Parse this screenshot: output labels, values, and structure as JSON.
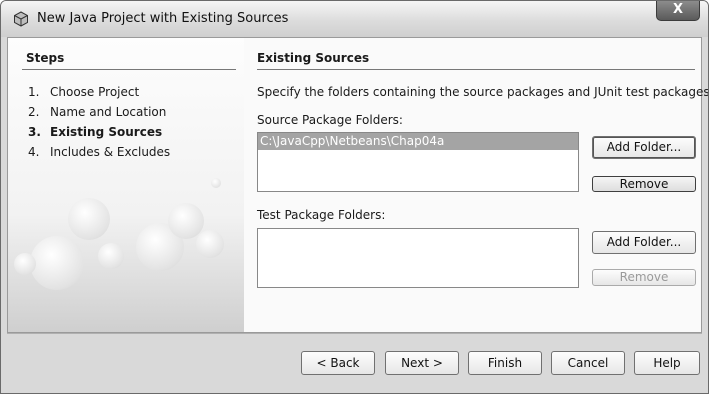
{
  "window": {
    "title": "New Java Project with Existing Sources",
    "close_glyph": "X",
    "icon": "java-project-icon"
  },
  "steps": {
    "title": "Steps",
    "items": [
      {
        "num": "1.",
        "label": "Choose Project"
      },
      {
        "num": "2.",
        "label": "Name and Location"
      },
      {
        "num": "3.",
        "label": "Existing Sources"
      },
      {
        "num": "4.",
        "label": "Includes & Excludes"
      }
    ],
    "current_index": 2
  },
  "panel": {
    "title": "Existing Sources",
    "description": "Specify the folders containing the source packages and JUnit test packages.",
    "source_label": "Source Package Folders:",
    "source_items": [
      "C:\\JavaCpp\\Netbeans\\Chap04a"
    ],
    "test_label": "Test Package Folders:",
    "test_items": [],
    "add_folder": "Add Folder...",
    "remove": "Remove"
  },
  "buttons": {
    "back": "< Back",
    "next": "Next >",
    "finish": "Finish",
    "cancel": "Cancel",
    "help": "Help"
  },
  "colors": {
    "selection": "#a4a4a4",
    "background": "#d9d9d9"
  }
}
